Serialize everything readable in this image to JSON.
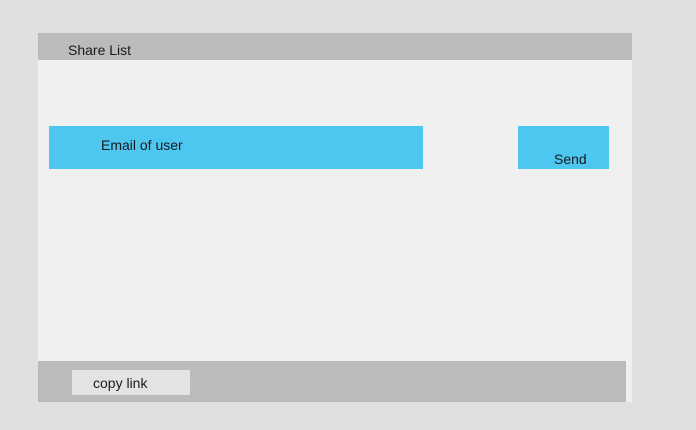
{
  "dialog": {
    "title": "Share List",
    "email_field": {
      "placeholder": "Email of user",
      "value": ""
    },
    "send_label": "Send",
    "footer": {
      "copy_link_label": "copy link"
    }
  },
  "colors": {
    "page_background": "#e0e0e0",
    "dialog_background": "#f0f0f0",
    "bar_background": "#bbbbbb",
    "accent": "#4dc6f0",
    "secondary_button": "#e3e3e3"
  }
}
